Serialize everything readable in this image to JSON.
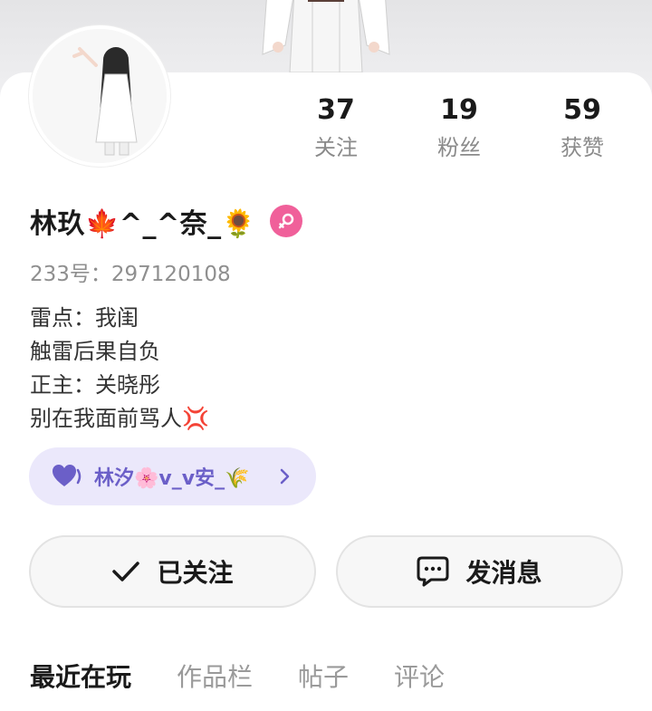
{
  "profile": {
    "nickname": "林玖🍁^_^奈_🌻",
    "gender": "female",
    "uid_text": "233号：297120108",
    "bio": [
      "雷点：我闺",
      "触雷后果自负",
      "正主：关晓彤",
      "别在我面前骂人💢"
    ]
  },
  "stats": [
    {
      "value": "37",
      "label": "关注"
    },
    {
      "value": "19",
      "label": "粉丝"
    },
    {
      "value": "59",
      "label": "获赞"
    }
  ],
  "relation": {
    "icon": "purple-heart-icon",
    "name": "林汐🌸v_v安_🌾"
  },
  "actions": {
    "follow_label": "已关注",
    "message_label": "发消息"
  },
  "tabs": [
    {
      "label": "最近在玩",
      "active": true
    },
    {
      "label": "作品栏",
      "active": false
    },
    {
      "label": "帖子",
      "active": false
    },
    {
      "label": "评论",
      "active": false
    }
  ],
  "colors": {
    "gender_badge": "#f0609a",
    "relation_bg": "#ebe8fb",
    "relation_text": "#6b5fc8"
  }
}
